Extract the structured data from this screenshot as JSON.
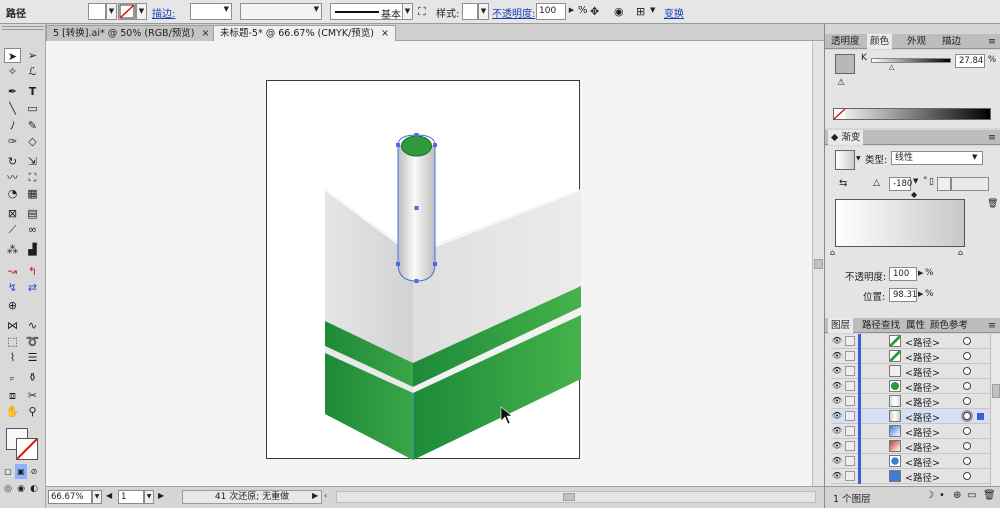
{
  "control_bar": {
    "object_label": "路径",
    "stroke_label": "描边:",
    "line_style_label": "基本",
    "style_label": "样式:",
    "opacity_label": "不透明度:",
    "opacity_value": "100",
    "opacity_unit": "%",
    "transform_label": "变换"
  },
  "tabs": [
    {
      "label": "5 [转换].ai* @ 50% (RGB/预览)",
      "active": false
    },
    {
      "label": "未标题-5* @ 66.67% (CMYK/预览)",
      "active": true
    }
  ],
  "tab_close": "×",
  "status": {
    "zoom": "66.67%",
    "page": "1",
    "undo_text": "41 次还原; 无重做"
  },
  "color_panel": {
    "tabs": [
      "透明度",
      "颜色",
      "外观",
      "描边"
    ],
    "active_tab": "颜色",
    "channel": "K",
    "value": "27.84",
    "unit": "%"
  },
  "gradient_panel": {
    "title": "渐变",
    "type_label": "类型:",
    "type_value": "线性",
    "angle_value": "-180",
    "angle_unit": "°",
    "opacity_label": "不透明度:",
    "opacity_value": "100",
    "opacity_unit": "%",
    "location_label": "位置:",
    "location_value": "98.31",
    "location_unit": "%"
  },
  "layers_panel": {
    "tabs": [
      "图层",
      "路径查找",
      "属性",
      "颜色参考"
    ],
    "active_tab": "图层",
    "rows": [
      {
        "name": "<路径>"
      },
      {
        "name": "<路径>"
      },
      {
        "name": "<路径>"
      },
      {
        "name": "<路径>"
      },
      {
        "name": "<路径>"
      },
      {
        "name": "<路径>"
      },
      {
        "name": "<路径>"
      },
      {
        "name": "<路径>"
      },
      {
        "name": "<路径>"
      },
      {
        "name": "<路径>"
      }
    ],
    "footer_text": "1 个图层"
  },
  "colors": {
    "green_dark": "#1d8a3a",
    "green_light": "#45b24a",
    "accent": "#3c5dd6"
  },
  "icons": [
    "selection-icon",
    "direct-selection-icon",
    "magic-wand-icon",
    "lasso-icon",
    "pen-icon",
    "type-icon",
    "line-icon",
    "rectangle-icon",
    "paintbrush-icon",
    "pencil-icon",
    "eraser-icon",
    "rotate-icon",
    "scale-icon",
    "warp-icon",
    "free-transform-icon",
    "shape-builder-icon",
    "perspective-icon",
    "mesh-icon",
    "gradient-icon",
    "eyedropper-icon",
    "blend-icon",
    "symbol-sprayer-icon",
    "graph-icon",
    "artboard-icon",
    "slice-icon",
    "hand-icon",
    "zoom-icon",
    "eye-icon"
  ]
}
